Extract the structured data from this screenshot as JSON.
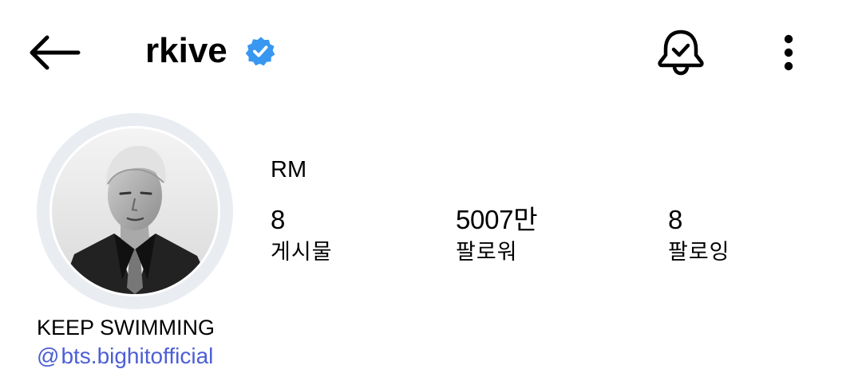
{
  "header": {
    "username": "rkive",
    "verified": true
  },
  "profile": {
    "display_name": "RM",
    "stats": [
      {
        "value": "8",
        "label": "게시물"
      },
      {
        "value": "5007만",
        "label": "팔로워"
      },
      {
        "value": "8",
        "label": "팔로잉"
      }
    ],
    "bio": "KEEP SWIMMING",
    "threads_symbol": "@",
    "link_text": "bts.bighitofficial"
  },
  "icons": {
    "back": "arrow-left-icon",
    "verified": "verified-badge-icon",
    "notifications": "bell-check-icon",
    "more": "vertical-dots-icon",
    "threads": "threads-icon"
  },
  "colors": {
    "verified_badge": "#3897f0",
    "link": "#4c5fd5",
    "avatar_ring": "#e9edf1"
  }
}
